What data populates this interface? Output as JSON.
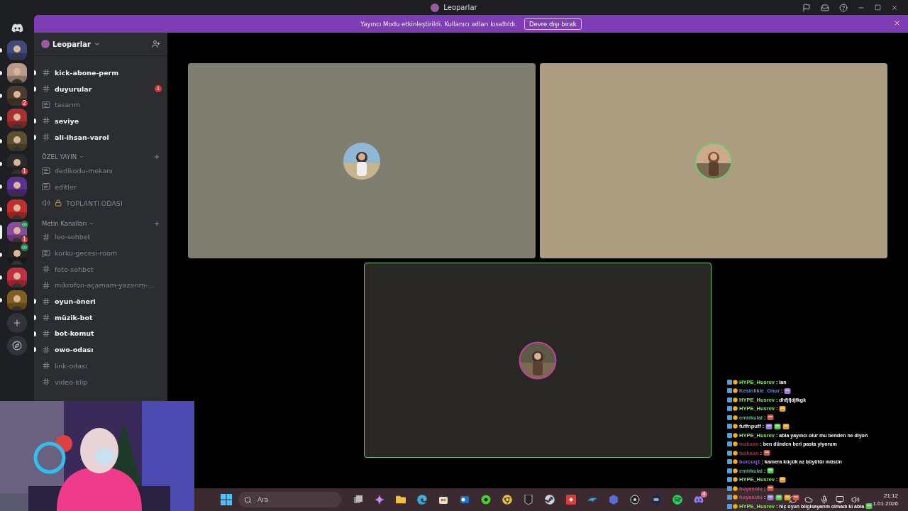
{
  "window": {
    "title": "Leoparlar"
  },
  "banner": {
    "text": "Yayıncı Modu etkinleştirildi. Kullanıcı adları kısaltıldı.",
    "button": "Devre dışı bırak"
  },
  "servers": [
    {
      "unread": true,
      "selected": false
    },
    {
      "unread": true,
      "selected": false
    },
    {
      "unread": true,
      "selected": false,
      "badge": "2"
    },
    {
      "unread": true,
      "selected": false
    },
    {
      "unread": true,
      "selected": false
    },
    {
      "unread": true,
      "selected": false,
      "badge": "1"
    },
    {
      "unread": true,
      "selected": false
    },
    {
      "unread": true,
      "selected": false
    },
    {
      "selected": true,
      "badge": "1",
      "voice": true
    },
    {
      "unread": true,
      "selected": false,
      "voice": true
    },
    {
      "unread": true,
      "selected": false
    },
    {
      "unread": true,
      "selected": false
    }
  ],
  "server_name": "Leoparlar",
  "channel_groups": [
    {
      "channels": [
        {
          "kind": "text",
          "name": "kick-abone-perm",
          "unread": true
        },
        {
          "kind": "text",
          "name": "duyurular",
          "unread": true,
          "badge": "1"
        },
        {
          "kind": "thread",
          "name": "tasarım",
          "unread": false
        },
        {
          "kind": "text",
          "name": "seviye",
          "unread": true
        },
        {
          "kind": "text",
          "name": "ali-ihsan-varol",
          "unread": true
        }
      ]
    },
    {
      "category": "ÖZEL YAYIN",
      "channels": [
        {
          "kind": "thread",
          "name": "dedikodu-mekanı",
          "unread": false
        },
        {
          "kind": "thread",
          "name": "editler",
          "unread": false
        },
        {
          "kind": "voice",
          "name": "TOPLANTI ODASI",
          "unread": false,
          "locked": true
        }
      ]
    },
    {
      "category": "Metin Kanalları",
      "channels": [
        {
          "kind": "text",
          "name": "leo-sohbet",
          "unread": false
        },
        {
          "kind": "thread",
          "name": "korku-gecesi-room",
          "unread": false
        },
        {
          "kind": "text",
          "name": "foto-sohbet",
          "unread": false
        },
        {
          "kind": "text",
          "name": "mikrofon-açamam-yazarım-...",
          "unread": false
        },
        {
          "kind": "text",
          "name": "oyun-öneri",
          "unread": true
        },
        {
          "kind": "text",
          "name": "müzik-bot",
          "unread": true
        },
        {
          "kind": "text",
          "name": "bot-komut",
          "unread": true
        },
        {
          "kind": "text",
          "name": "owo-odası",
          "unread": true
        },
        {
          "kind": "text",
          "name": "link-odası",
          "unread": false
        },
        {
          "kind": "text",
          "name": "video-klip",
          "unread": false
        }
      ]
    }
  ],
  "tiles": [
    {
      "speaking": false,
      "color": "#7f7e6f"
    },
    {
      "speaking": false,
      "color": "#ac9c80"
    },
    {
      "speaking": true,
      "color": "#282723"
    }
  ],
  "chat": [
    {
      "name": "HYPE_Husrev",
      "color": "#7cf53a",
      "text": ": lan"
    },
    {
      "name": "Kesinlikle_Onur",
      "color": "#5b8fd4",
      "text": ":",
      "emotes": [
        {
          "kind": "emote"
        }
      ]
    },
    {
      "name": "HYPE_Husrev",
      "color": "#7cf53a",
      "text": ": dhfjfjdjfkgk"
    },
    {
      "name": "HYPE_Husrev",
      "color": "#7cf53a",
      "text": ":",
      "emotes": [
        {
          "kind": "emote"
        }
      ]
    },
    {
      "name": "emirkulal",
      "color": "#3fc49a",
      "text": ":",
      "emotes": [
        {
          "kind": "emote"
        }
      ]
    },
    {
      "name": "fuffnpuff",
      "color": "#e8e8e8",
      "text": ":",
      "emotes": [
        {
          "kind": "emote"
        },
        {
          "kind": "emote"
        },
        {
          "kind": "emote"
        }
      ]
    },
    {
      "name": "HYPE_Husrev",
      "color": "#7cf53a",
      "text": ": abla yayıncı olur mu benden ne diyon"
    },
    {
      "name": "tazkaan",
      "color": "#b4234a",
      "text": ": ben dünden beri pasta yiyorum"
    },
    {
      "name": "tazkaan",
      "color": "#b4234a",
      "text": ":",
      "emotes": [
        {
          "kind": "emote"
        }
      ]
    },
    {
      "name": "burcuq1",
      "color": "#8a5cf0",
      "text": ": kamera küçük az büyütür müsün"
    },
    {
      "name": "emirkulal",
      "color": "#3fc49a",
      "text": ":",
      "emotes": [
        {
          "kind": "emote"
        }
      ]
    },
    {
      "name": "HYPE_Husrev",
      "color": "#7cf53a",
      "text": ":",
      "emotes": [
        {
          "kind": "emote"
        }
      ]
    },
    {
      "name": "huyasolu",
      "color": "#c0507a",
      "text": ":",
      "emotes": [
        {
          "kind": "emote"
        }
      ]
    },
    {
      "name": "huyasolu",
      "color": "#c0507a",
      "text": ":",
      "emotes": [
        {
          "kind": "emote"
        },
        {
          "kind": "emote"
        },
        {
          "kind": "emote"
        },
        {
          "kind": "emote"
        }
      ]
    },
    {
      "name": "HYPE_Husrev",
      "color": "#7cf53a",
      "text": ": hiç oyun bilgisayarım olmadı ki abla",
      "emotes": [
        {
          "kind": "emote"
        }
      ]
    }
  ],
  "taskbar": {
    "search_placeholder": "Ara",
    "discord_badge": "4",
    "time": "21:12",
    "date": "1.01.2026"
  }
}
